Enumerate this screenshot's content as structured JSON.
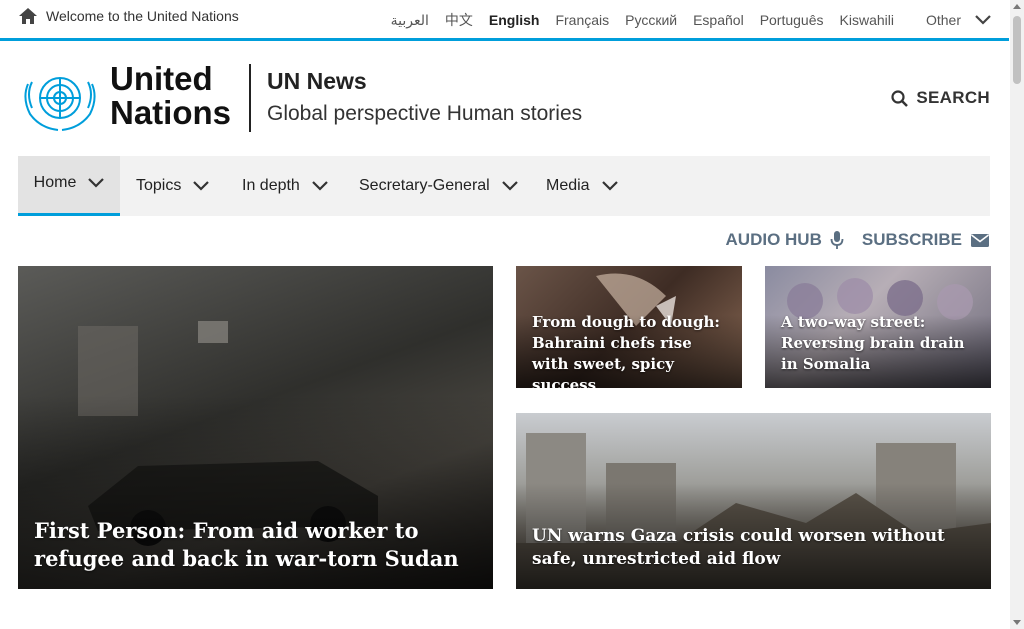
{
  "topbar": {
    "welcome": "Welcome to the United Nations",
    "languages": [
      "العربية",
      "中文",
      "English",
      "Français",
      "Русский",
      "Español",
      "Português",
      "Kiswahili"
    ],
    "active_language": "English",
    "other": "Other"
  },
  "header": {
    "logo_line1": "United",
    "logo_line2": "Nations",
    "site_title": "UN News",
    "tagline": "Global perspective Human stories",
    "search_label": "SEARCH"
  },
  "nav": {
    "items": [
      "Home",
      "Topics",
      "In depth",
      "Secretary-General",
      "Media"
    ]
  },
  "utility": {
    "audio_hub": "AUDIO HUB",
    "subscribe": "SUBSCRIBE"
  },
  "stories": [
    {
      "headline": "First Person: From aid worker to refugee and back in war-torn Sudan"
    },
    {
      "headline": "From dough to dough: Bahraini chefs rise with sweet, spicy success"
    },
    {
      "headline": "A two-way street: Reversing brain drain in Somalia"
    },
    {
      "headline": "UN warns Gaza crisis could worsen without safe, unrestricted aid flow"
    }
  ],
  "colors": {
    "accent": "#009edb",
    "utility_text": "#5b6f82",
    "nav_bg": "#f2f2f2"
  }
}
